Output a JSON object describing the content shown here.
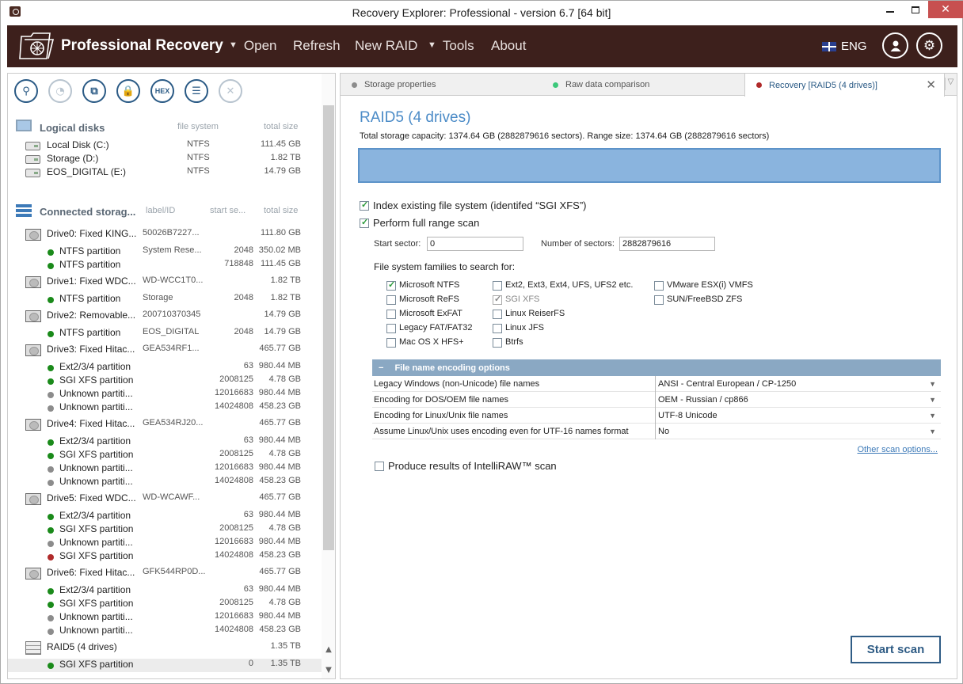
{
  "window": {
    "title": "Recovery Explorer: Professional - version 6.7 [64 bit]"
  },
  "header": {
    "brand": "Professional Recovery",
    "menu": [
      {
        "label": "Open",
        "has_caret": true
      },
      {
        "label": "Refresh",
        "has_caret": false
      },
      {
        "label": "New RAID",
        "has_caret": false
      },
      {
        "label": "Tools",
        "has_caret": true
      },
      {
        "label": "About",
        "has_caret": false
      }
    ],
    "language": "ENG",
    "accent_color": "#3d201c"
  },
  "toolbar": {
    "buttons": [
      {
        "icon": "search-icon",
        "label": "⚲",
        "enabled": true
      },
      {
        "icon": "scan-icon",
        "label": "◔",
        "enabled": false
      },
      {
        "icon": "image-icon",
        "label": "⧉",
        "enabled": true
      },
      {
        "icon": "lock-icon",
        "label": "🔒",
        "enabled": true
      },
      {
        "icon": "hex-icon",
        "label": "HEX",
        "enabled": true
      },
      {
        "icon": "list-icon",
        "label": "☰",
        "enabled": true
      },
      {
        "icon": "close-icon",
        "label": "✕",
        "enabled": false
      }
    ]
  },
  "logical_disks": {
    "title": "Logical disks",
    "col_fs": "file system",
    "col_size": "total size",
    "items": [
      {
        "name": "Local Disk (C:)",
        "fs": "NTFS",
        "size": "111.45 GB"
      },
      {
        "name": "Storage (D:)",
        "fs": "NTFS",
        "size": "1.82 TB"
      },
      {
        "name": "EOS_DIGITAL (E:)",
        "fs": "NTFS",
        "size": "14.79 GB"
      }
    ]
  },
  "connected_storage": {
    "title": "Connected storag...",
    "col_label": "label/ID",
    "col_start": "start se...",
    "col_size": "total size",
    "devices": [
      {
        "name": "Drive0: Fixed KING...",
        "id": "50026B7227...",
        "size": "111.80 GB",
        "type": "drive",
        "partitions": [
          {
            "name": "NTFS partition",
            "label": "System Rese...",
            "start": "2048",
            "size": "350.02 MB",
            "status": "green"
          },
          {
            "name": "NTFS partition",
            "label": "",
            "start": "718848",
            "size": "111.45 GB",
            "status": "green"
          }
        ]
      },
      {
        "name": "Drive1: Fixed WDC...",
        "id": "WD-WCC1T0...",
        "size": "1.82 TB",
        "type": "drive",
        "partitions": [
          {
            "name": "NTFS partition",
            "label": "Storage",
            "start": "2048",
            "size": "1.82 TB",
            "status": "green"
          }
        ]
      },
      {
        "name": "Drive2: Removable...",
        "id": "200710370345",
        "size": "14.79 GB",
        "type": "drive",
        "partitions": [
          {
            "name": "NTFS partition",
            "label": "EOS_DIGITAL",
            "start": "2048",
            "size": "14.79 GB",
            "status": "green"
          }
        ]
      },
      {
        "name": "Drive3: Fixed Hitac...",
        "id": "GEA534RF1...",
        "size": "465.77 GB",
        "type": "drive",
        "partitions": [
          {
            "name": "Ext2/3/4 partition",
            "label": "",
            "start": "63",
            "size": "980.44 MB",
            "status": "green"
          },
          {
            "name": "SGI XFS partition",
            "label": "",
            "start": "2008125",
            "size": "4.78 GB",
            "status": "green"
          },
          {
            "name": "Unknown partiti...",
            "label": "",
            "start": "12016683",
            "size": "980.44 MB",
            "status": "grey"
          },
          {
            "name": "Unknown partiti...",
            "label": "",
            "start": "14024808",
            "size": "458.23 GB",
            "status": "grey"
          }
        ]
      },
      {
        "name": "Drive4: Fixed Hitac...",
        "id": "GEA534RJ20...",
        "size": "465.77 GB",
        "type": "drive",
        "partitions": [
          {
            "name": "Ext2/3/4 partition",
            "label": "",
            "start": "63",
            "size": "980.44 MB",
            "status": "green"
          },
          {
            "name": "SGI XFS partition",
            "label": "",
            "start": "2008125",
            "size": "4.78 GB",
            "status": "green"
          },
          {
            "name": "Unknown partiti...",
            "label": "",
            "start": "12016683",
            "size": "980.44 MB",
            "status": "grey"
          },
          {
            "name": "Unknown partiti...",
            "label": "",
            "start": "14024808",
            "size": "458.23 GB",
            "status": "grey"
          }
        ]
      },
      {
        "name": "Drive5: Fixed WDC...",
        "id": "WD-WCAWF...",
        "size": "465.77 GB",
        "type": "drive",
        "partitions": [
          {
            "name": "Ext2/3/4 partition",
            "label": "",
            "start": "63",
            "size": "980.44 MB",
            "status": "green"
          },
          {
            "name": "SGI XFS partition",
            "label": "",
            "start": "2008125",
            "size": "4.78 GB",
            "status": "green"
          },
          {
            "name": "Unknown partiti...",
            "label": "",
            "start": "12016683",
            "size": "980.44 MB",
            "status": "grey"
          },
          {
            "name": "SGI XFS partition",
            "label": "",
            "start": "14024808",
            "size": "458.23 GB",
            "status": "red"
          }
        ]
      },
      {
        "name": "Drive6: Fixed Hitac...",
        "id": "GFK544RP0D...",
        "size": "465.77 GB",
        "type": "drive",
        "partitions": [
          {
            "name": "Ext2/3/4 partition",
            "label": "",
            "start": "63",
            "size": "980.44 MB",
            "status": "green"
          },
          {
            "name": "SGI XFS partition",
            "label": "",
            "start": "2008125",
            "size": "4.78 GB",
            "status": "green"
          },
          {
            "name": "Unknown partiti...",
            "label": "",
            "start": "12016683",
            "size": "980.44 MB",
            "status": "grey"
          },
          {
            "name": "Unknown partiti...",
            "label": "",
            "start": "14024808",
            "size": "458.23 GB",
            "status": "grey"
          }
        ]
      },
      {
        "name": "RAID5 (4 drives)",
        "id": "",
        "size": "1.35 TB",
        "type": "raid",
        "partitions": [
          {
            "name": "SGI XFS partition",
            "label": "",
            "start": "0",
            "size": "1.35 TB",
            "status": "green",
            "selected": true
          }
        ]
      }
    ]
  },
  "status_colors": {
    "green": "#1a8a1a",
    "grey": "#8c8c8c",
    "red": "#b02a2a"
  },
  "tabs": [
    {
      "label": "Storage properties",
      "dot": "#8c8c8c",
      "active": false
    },
    {
      "label": "Raw data comparison",
      "dot": "#3cc87a",
      "active": false
    },
    {
      "label": "Recovery [RAID5 (4 drives)]",
      "dot": "#b02a2a",
      "active": true
    }
  ],
  "recovery": {
    "title": "RAID5 (4 drives)",
    "capacity_text": "Total storage capacity: 1374.64 GB (2882879616 sectors). Range size: 1374.64 GB (2882879616 sectors)",
    "index_fs": {
      "label": "Index existing file system (identifed “SGI XFS”)",
      "checked": true
    },
    "full_scan": {
      "label": "Perform full range scan",
      "checked": true
    },
    "start_sector_label": "Start sector:",
    "start_sector_value": "0",
    "num_sectors_label": "Number of sectors:",
    "num_sectors_value": "2882879616",
    "fs_families_label": "File system families to search for:",
    "fs_columns": [
      [
        {
          "label": "Microsoft NTFS",
          "checked": true,
          "disabled": false
        },
        {
          "label": "Microsoft ReFS",
          "checked": false,
          "disabled": false
        },
        {
          "label": "Microsoft ExFAT",
          "checked": false,
          "disabled": false
        },
        {
          "label": "Legacy FAT/FAT32",
          "checked": false,
          "disabled": false
        },
        {
          "label": "Mac OS X HFS+",
          "checked": false,
          "disabled": false
        }
      ],
      [
        {
          "label": "Ext2, Ext3, Ext4, UFS, UFS2 etc.",
          "checked": false,
          "disabled": false
        },
        {
          "label": "SGI XFS",
          "checked": true,
          "disabled": true
        },
        {
          "label": "Linux ReiserFS",
          "checked": false,
          "disabled": false
        },
        {
          "label": "Linux JFS",
          "checked": false,
          "disabled": false
        },
        {
          "label": "Btrfs",
          "checked": false,
          "disabled": false
        }
      ],
      [
        {
          "label": "VMware ESX(i) VMFS",
          "checked": false,
          "disabled": false
        },
        {
          "label": "SUN/FreeBSD ZFS",
          "checked": false,
          "disabled": false
        }
      ]
    ],
    "encoding": {
      "title": "File name encoding options",
      "rows": [
        {
          "key": "Legacy Windows (non-Unicode) file names",
          "value": "ANSI - Central European / CP-1250"
        },
        {
          "key": "Encoding for DOS/OEM file names",
          "value": "OEM - Russian / cp866"
        },
        {
          "key": "Encoding for Linux/Unix file names",
          "value": "UTF-8 Unicode"
        },
        {
          "key": "Assume Linux/Unix uses encoding even for UTF-16 names format",
          "value": "No"
        }
      ]
    },
    "other_options_link": "Other scan options...",
    "intelliraw": {
      "label": "Produce results of IntelliRAW™ scan",
      "checked": false
    },
    "start_button": "Start scan"
  }
}
